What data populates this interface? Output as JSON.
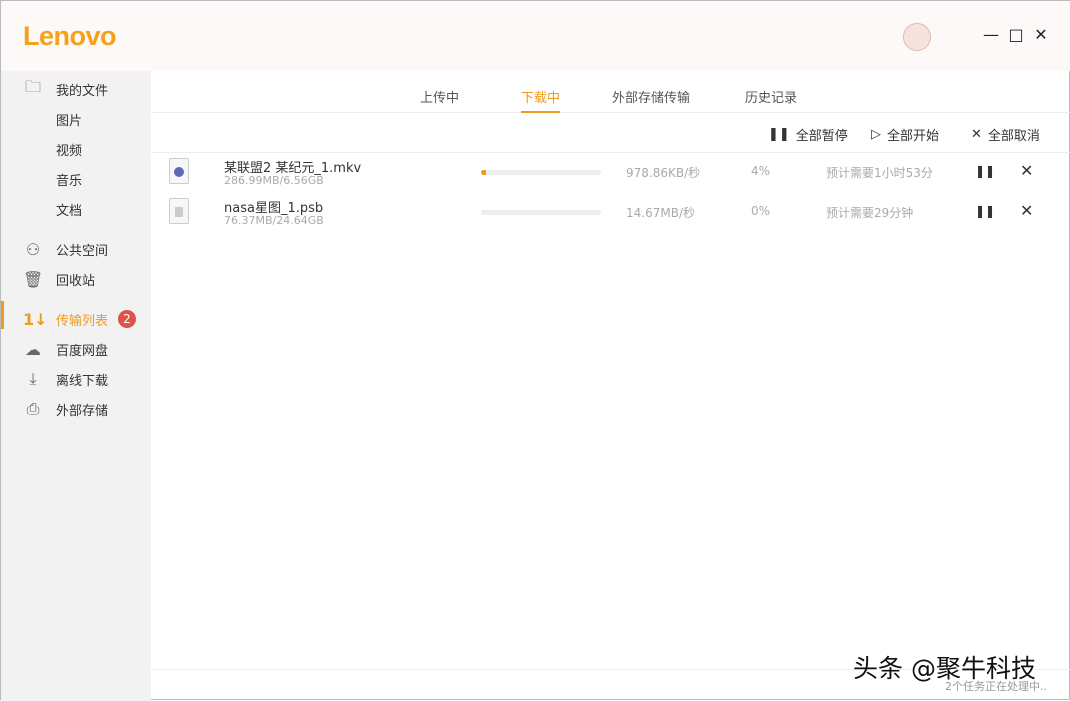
{
  "header": {
    "logo": "Lenovo",
    "minimize": "—",
    "maximize": "□",
    "close": "✕"
  },
  "sidebar": {
    "items": [
      {
        "label": "我的文件",
        "icon": "folder-icon"
      },
      {
        "label": "图片"
      },
      {
        "label": "视频"
      },
      {
        "label": "音乐"
      },
      {
        "label": "文档"
      },
      {
        "label": "公共空间",
        "icon": "users-icon"
      },
      {
        "label": "回收站",
        "icon": "trash-icon"
      },
      {
        "label": "传输列表",
        "icon": "transfer-icon",
        "badge": "2"
      },
      {
        "label": "百度网盘",
        "icon": "cloud-icon"
      },
      {
        "label": "离线下载",
        "icon": "download-icon"
      },
      {
        "label": "外部存储",
        "icon": "usb-icon"
      }
    ]
  },
  "tabs": [
    "上传中",
    "下载中",
    "外部存储传输",
    "历史记录"
  ],
  "toolbar": {
    "pause_all": "全部暂停",
    "start_all": "全部开始",
    "cancel_all": "全部取消"
  },
  "downloads": [
    {
      "name": "某联盟2 某纪元_1.mkv",
      "size": "286.99MB/6.56GB",
      "speed": "978.86KB/秒",
      "percent": "4%",
      "progress": 4,
      "eta": "预计需要1小时53分",
      "type": "video"
    },
    {
      "name": "nasa星图_1.psb",
      "size": "76.37MB/24.64GB",
      "speed": "14.67MB/秒",
      "percent": "0%",
      "progress": 0,
      "eta": "预计需要29分钟",
      "type": "file"
    }
  ],
  "status": "2个任务正在处理中..",
  "watermark": "头条 @聚牛科技"
}
